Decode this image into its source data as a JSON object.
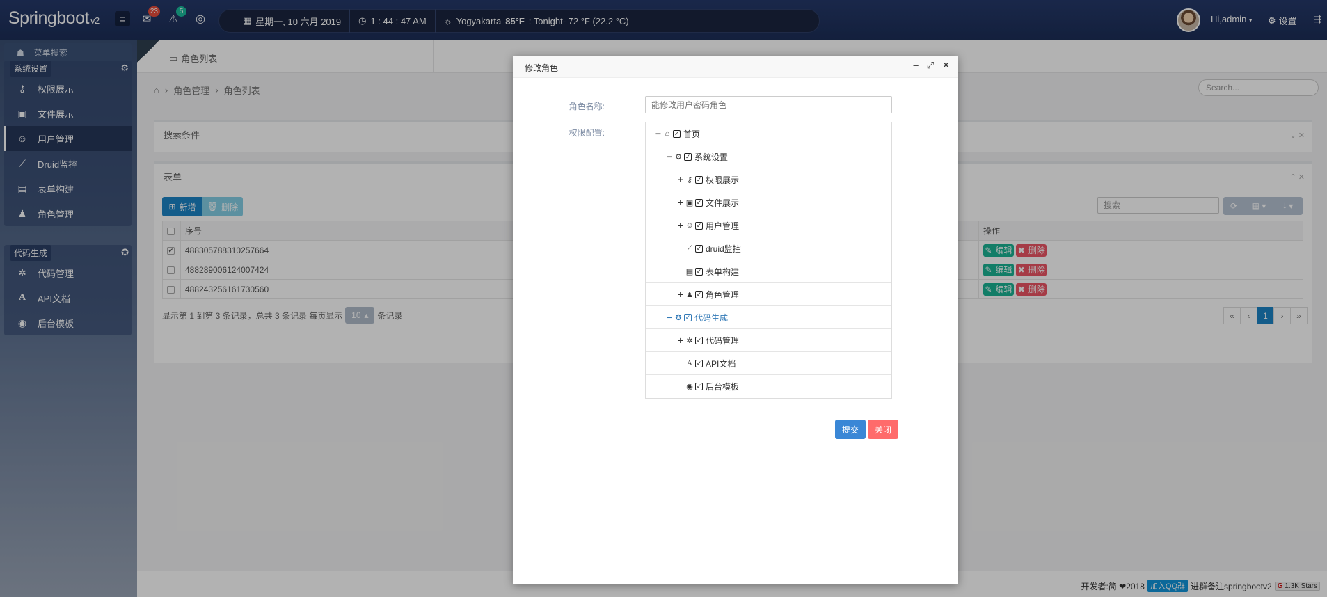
{
  "header": {
    "brand": "Springboot",
    "brand_version": "v2",
    "msg_count": "23",
    "alert_count": "5",
    "date": "星期一, 10 六月 2019",
    "time": "1 : 44 : 47 AM",
    "weather_city": "Yogyakarta",
    "weather_temp": "85°F",
    "weather_tonight": ": Tonight- 72 °F (22.2 °C)",
    "user_greeting": "Hi,admin",
    "settings_label": "设置"
  },
  "sidebar": {
    "search_label": "菜单搜索",
    "groups": [
      {
        "title": "系统设置",
        "items": [
          {
            "label": "权限展示",
            "icon": "key-icon"
          },
          {
            "label": "文件展示",
            "icon": "image-icon"
          },
          {
            "label": "用户管理",
            "icon": "user-icon"
          },
          {
            "label": "Druid监控",
            "icon": "line-chart-icon"
          },
          {
            "label": "表单构建",
            "icon": "table-icon"
          },
          {
            "label": "角色管理",
            "icon": "users-icon"
          }
        ]
      },
      {
        "title": "代码生成",
        "items": [
          {
            "label": "代码管理",
            "icon": "bug-icon"
          },
          {
            "label": "API文档",
            "icon": "font-icon"
          },
          {
            "label": "后台模板",
            "icon": "compass-icon"
          }
        ]
      }
    ]
  },
  "main": {
    "tab_label": "角色列表",
    "breadcrumb": [
      "角色管理",
      "角色列表"
    ],
    "search_placeholder": "Search...",
    "search_panel_title": "搜索条件",
    "table_panel_title": "表单",
    "add_label": "新增",
    "delete_label": "删除",
    "table_search_placeholder": "搜索",
    "columns": [
      "序号",
      "操作"
    ],
    "rows": [
      {
        "id": "488305788310257664",
        "checked": true
      },
      {
        "id": "488289006124007424",
        "checked": false
      },
      {
        "id": "488243256161730560",
        "checked": false
      }
    ],
    "edit_label": "编辑",
    "row_delete_label": "删除",
    "pagination_text": "显示第 1 到第 3 条记录，总共 3 条记录 每页显示",
    "page_size": "10",
    "page_suffix": "条记录",
    "pages": [
      "«",
      "‹",
      "1",
      "›",
      "»"
    ],
    "current_page": "1"
  },
  "modal": {
    "title": "修改角色",
    "role_name_label": "角色名称:",
    "role_name_placeholder": "能修改用户密码角色",
    "perm_label": "权限配置:",
    "tree": [
      {
        "label": "首页",
        "toggle": "−",
        "icon": "home-icon",
        "glyph": "⌂",
        "indent": 0
      },
      {
        "label": "系统设置",
        "toggle": "−",
        "icon": "gear-icon",
        "glyph": "⚙",
        "indent": 1
      },
      {
        "label": "权限展示",
        "toggle": "+",
        "icon": "key-icon",
        "glyph": "⚷",
        "indent": 2
      },
      {
        "label": "文件展示",
        "toggle": "+",
        "icon": "image-icon",
        "glyph": "▣",
        "indent": 2
      },
      {
        "label": "用户管理",
        "toggle": "+",
        "icon": "user-icon",
        "glyph": "☺",
        "indent": 2
      },
      {
        "label": "druid监控",
        "toggle": "",
        "icon": "line-chart-icon",
        "glyph": "⟋",
        "indent": 2
      },
      {
        "label": "表单构建",
        "toggle": "",
        "icon": "table-icon",
        "glyph": "▤",
        "indent": 2
      },
      {
        "label": "角色管理",
        "toggle": "+",
        "icon": "users-icon",
        "glyph": "♟",
        "indent": 2
      },
      {
        "label": "代码生成",
        "toggle": "−",
        "icon": "rebel-icon",
        "glyph": "✪",
        "indent": 1,
        "highlight": true
      },
      {
        "label": "代码管理",
        "toggle": "+",
        "icon": "bug-icon",
        "glyph": "✲",
        "indent": 2
      },
      {
        "label": "API文档",
        "toggle": "",
        "icon": "font-icon",
        "glyph": "A",
        "indent": 2
      },
      {
        "label": "后台模板",
        "toggle": "",
        "icon": "compass-icon",
        "glyph": "◉",
        "indent": 2
      }
    ],
    "submit_label": "提交",
    "close_label": "关闭"
  },
  "footer": {
    "dev_text": "开发者:简 ❤2018",
    "qq_label": "加入QQ群",
    "note": "进群备注springbootv2",
    "stars": "1.3K Stars"
  },
  "colors": {
    "primary": "#1c84c6",
    "danger": "#ed5565",
    "success": "#1ab394",
    "submit": "#3a87d6",
    "close": "#ff6b6b"
  }
}
